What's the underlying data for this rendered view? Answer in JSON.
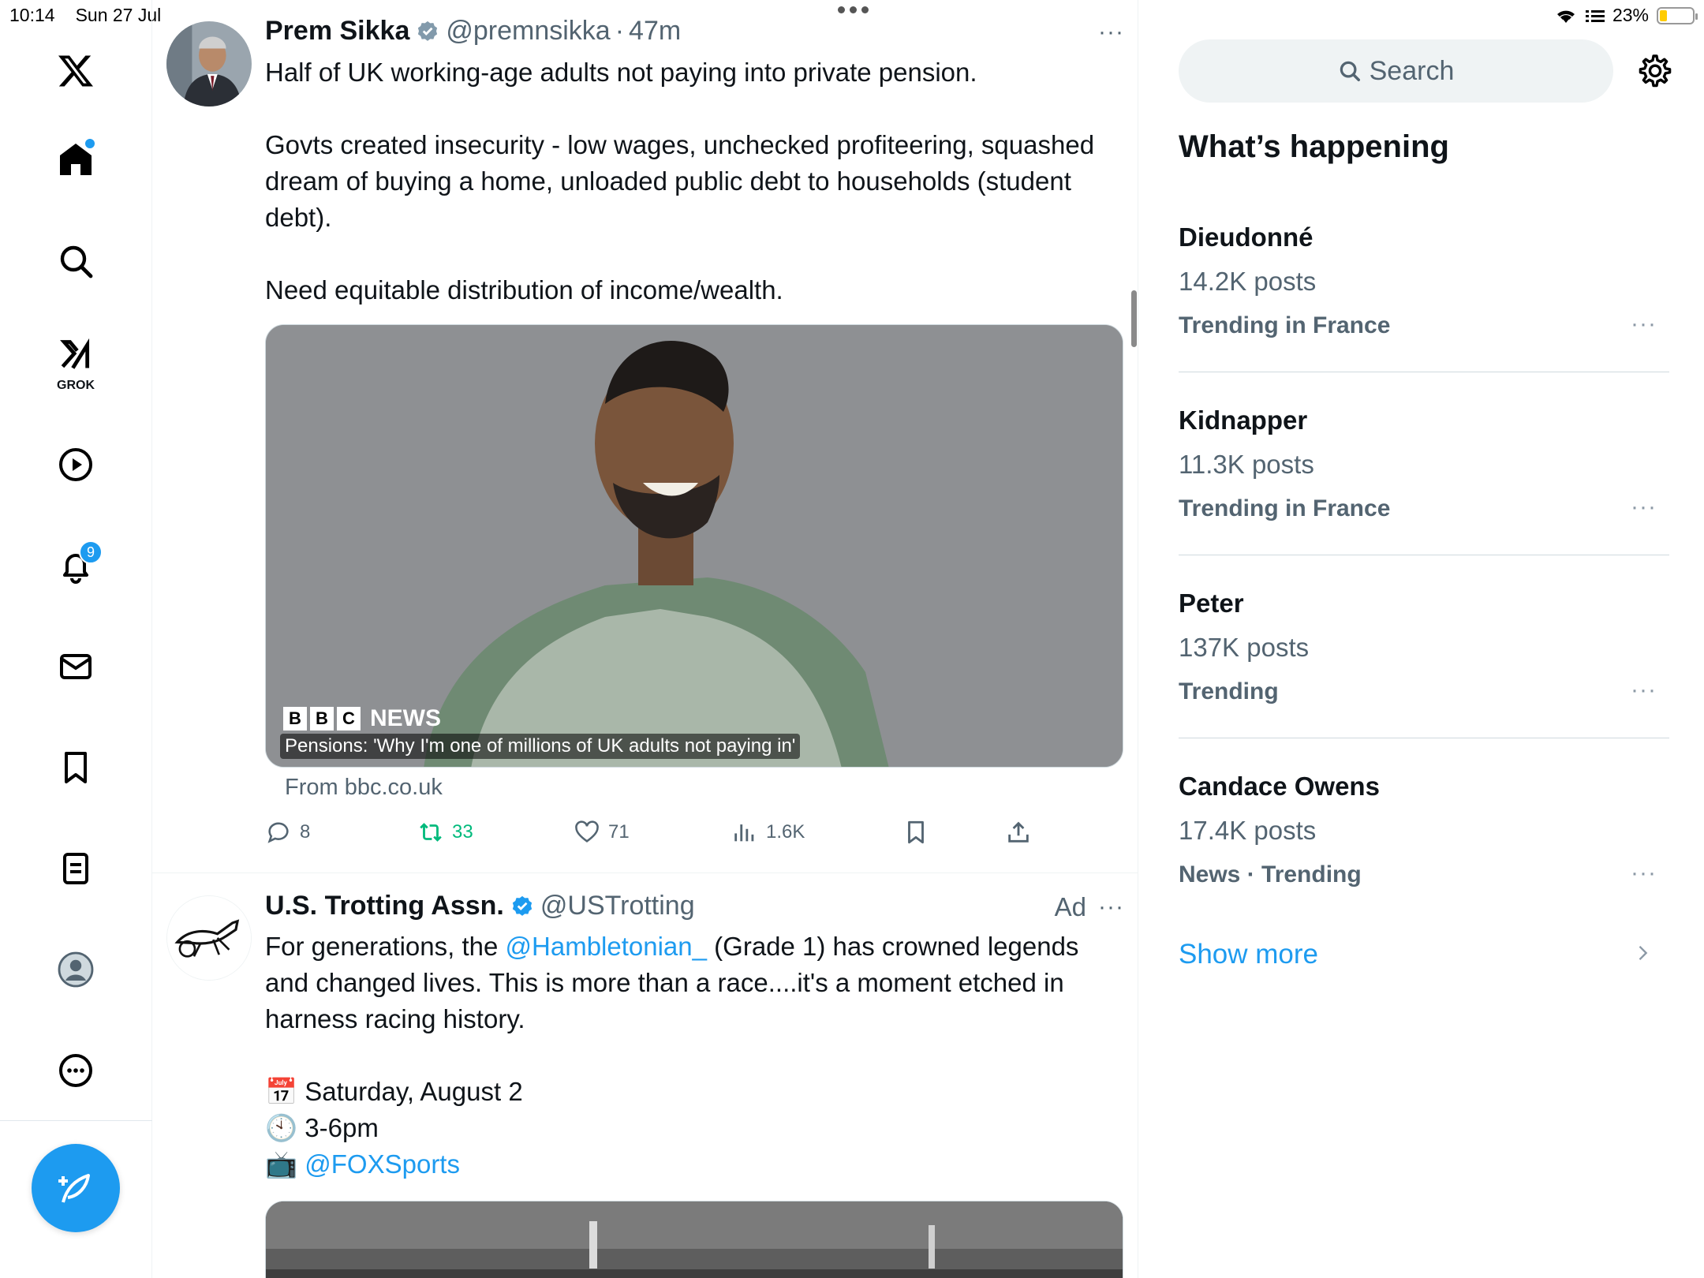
{
  "status_bar": {
    "time": "10:14",
    "date": "Sun 27 Jul",
    "battery": "23%",
    "battery_level": 0.23
  },
  "nav": {
    "items": [
      "X",
      "Home",
      "Explore",
      "Grok",
      "Videos",
      "Notifications",
      "Messages",
      "Bookmarks",
      "Lists",
      "Profile",
      "More"
    ],
    "grok_label": "GROK",
    "notification_count": "9"
  },
  "timeline": {
    "tweet1": {
      "name": "Prem Sikka",
      "handle": "@premnsikka",
      "sep": "·",
      "time": "47m",
      "more": "···",
      "lines": [
        "Half of UK working-age adults not paying into private pension.",
        "",
        "Govts created insecurity - low wages, unchecked profiteering, squashed dream of buying a home, unloaded public debt to households (student debt).",
        "",
        "Need equitable distribution of income/wealth."
      ],
      "card": {
        "brand": "NEWS",
        "brand_letters": [
          "B",
          "B",
          "C"
        ],
        "caption": "Pensions: 'Why I'm one of millions of UK adults not paying in'",
        "source": "From bbc.co.uk"
      },
      "stats": {
        "replies": "8",
        "retweets": "33",
        "likes": "71",
        "views": "1.6K"
      }
    },
    "tweet2": {
      "name": "U.S. Trotting Assn.",
      "handle": "@USTrotting",
      "ad": "Ad",
      "more": "···",
      "text_before": "For generations, the ",
      "mention": "@Hambletonian_",
      "text_after": " (Grade 1) has crowned legends and changed lives. This is more than a race....it's a moment etched in harness racing history.",
      "date_emoji": "📅",
      "date": "Saturday, August 2",
      "time_emoji": "🕙",
      "time": "3-6pm",
      "tv_emoji": "📺",
      "channel": "@FOXSports"
    }
  },
  "sidebar": {
    "search_placeholder": "Search",
    "title": "What’s happening",
    "trends": [
      {
        "name": "Dieudonné",
        "count": "14.2K posts",
        "context": "Trending in France"
      },
      {
        "name": "Kidnapper",
        "count": "11.3K posts",
        "context": "Trending in France"
      },
      {
        "name": "Peter",
        "count": "137K posts",
        "context": "Trending"
      },
      {
        "name": "Candace Owens",
        "count": "17.4K posts",
        "context": "News · Trending"
      }
    ],
    "trend_more": "···",
    "show_more": "Show more"
  },
  "colors": {
    "accent": "#1d9bf0",
    "retweet": "#00ba7c",
    "muted": "#536471"
  }
}
